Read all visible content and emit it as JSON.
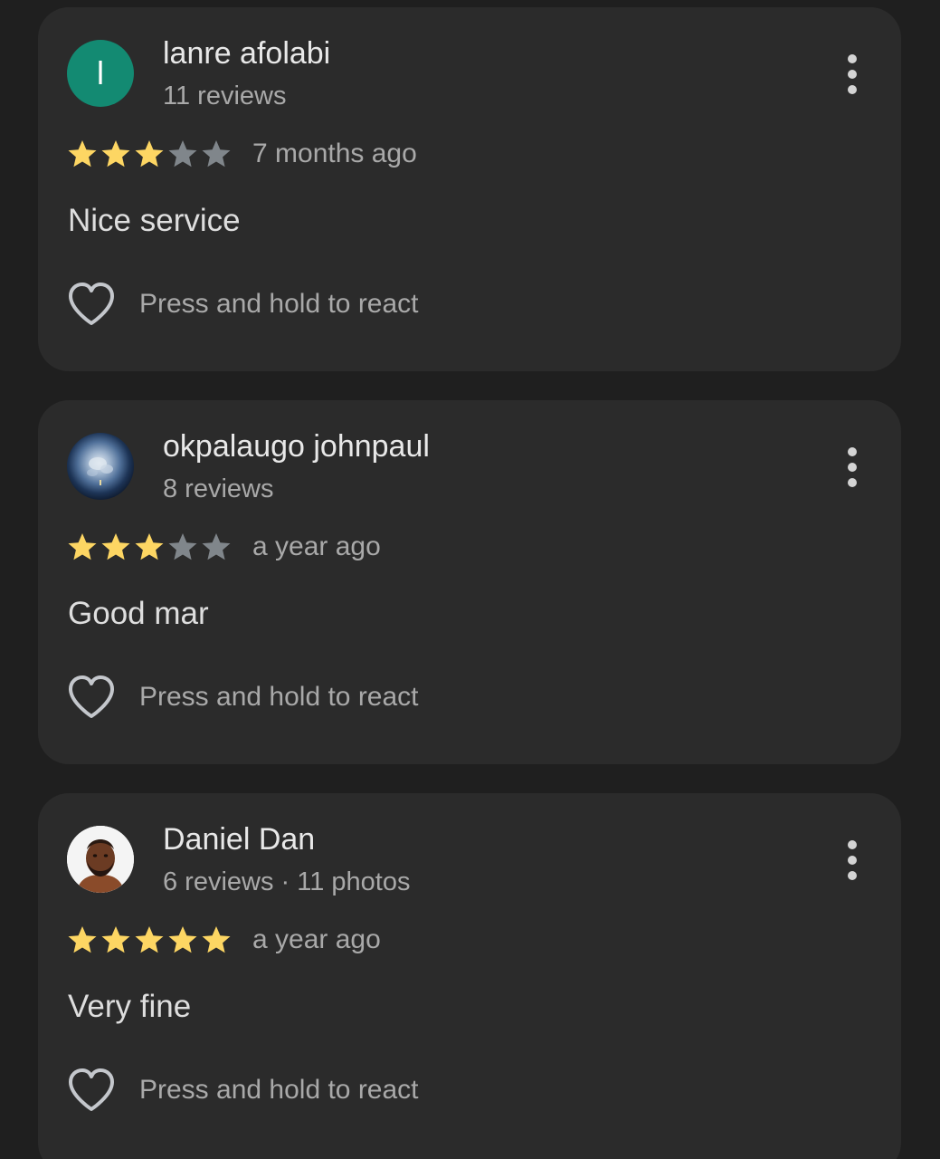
{
  "reviews": [
    {
      "name": "lanre afolabi",
      "meta": "11 reviews",
      "avatar_letter": "l",
      "avatar_type": "letter",
      "avatar_color": "#138a72",
      "rating": 3,
      "max_rating": 5,
      "time": "7 months ago",
      "text": "Nice service",
      "react_label": "Press and hold to react"
    },
    {
      "name": "okpalaugo johnpaul",
      "meta": "8 reviews",
      "avatar_type": "photo-earth",
      "rating": 3,
      "max_rating": 5,
      "time": "a year ago",
      "text": "Good mar",
      "react_label": "Press and hold to react"
    },
    {
      "name": "Daniel Dan",
      "meta": "6 reviews · 11 photos",
      "avatar_type": "photo-person",
      "rating": 5,
      "max_rating": 5,
      "time": "a year ago",
      "text": "Very fine",
      "react_label": "Press and hold to react"
    }
  ],
  "colors": {
    "background": "#1f1f1f",
    "card": "#2b2b2b",
    "star_filled": "#fdd663",
    "star_empty": "#80868b",
    "primary_text": "#e8e8e8",
    "secondary_text": "#a9a9a9"
  },
  "icons": {
    "more": "more-vert-icon",
    "react": "heart-outline-icon",
    "star": "star-icon"
  }
}
